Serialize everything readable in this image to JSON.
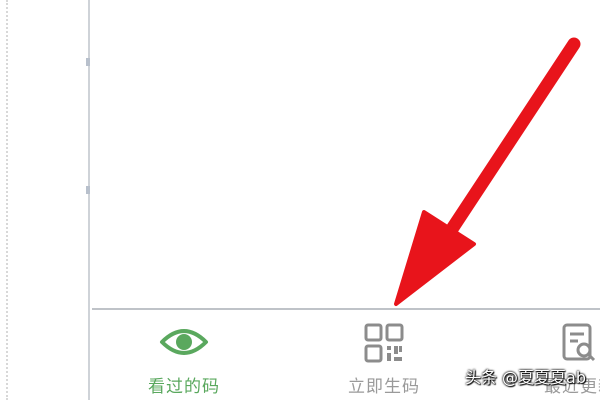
{
  "tabbar": {
    "tabs": [
      {
        "label": "看过的码",
        "icon": "eye-icon",
        "active": true
      },
      {
        "label": "立即生码",
        "icon": "qr-code-icon",
        "active": false
      },
      {
        "label": "最近更新",
        "icon": "document-search-icon",
        "active": false
      }
    ]
  },
  "watermark": "头条 @夏夏夏ab",
  "colors": {
    "active": "#5aa85e",
    "inactive": "#9a9a9a",
    "arrow": "#e8141b"
  }
}
